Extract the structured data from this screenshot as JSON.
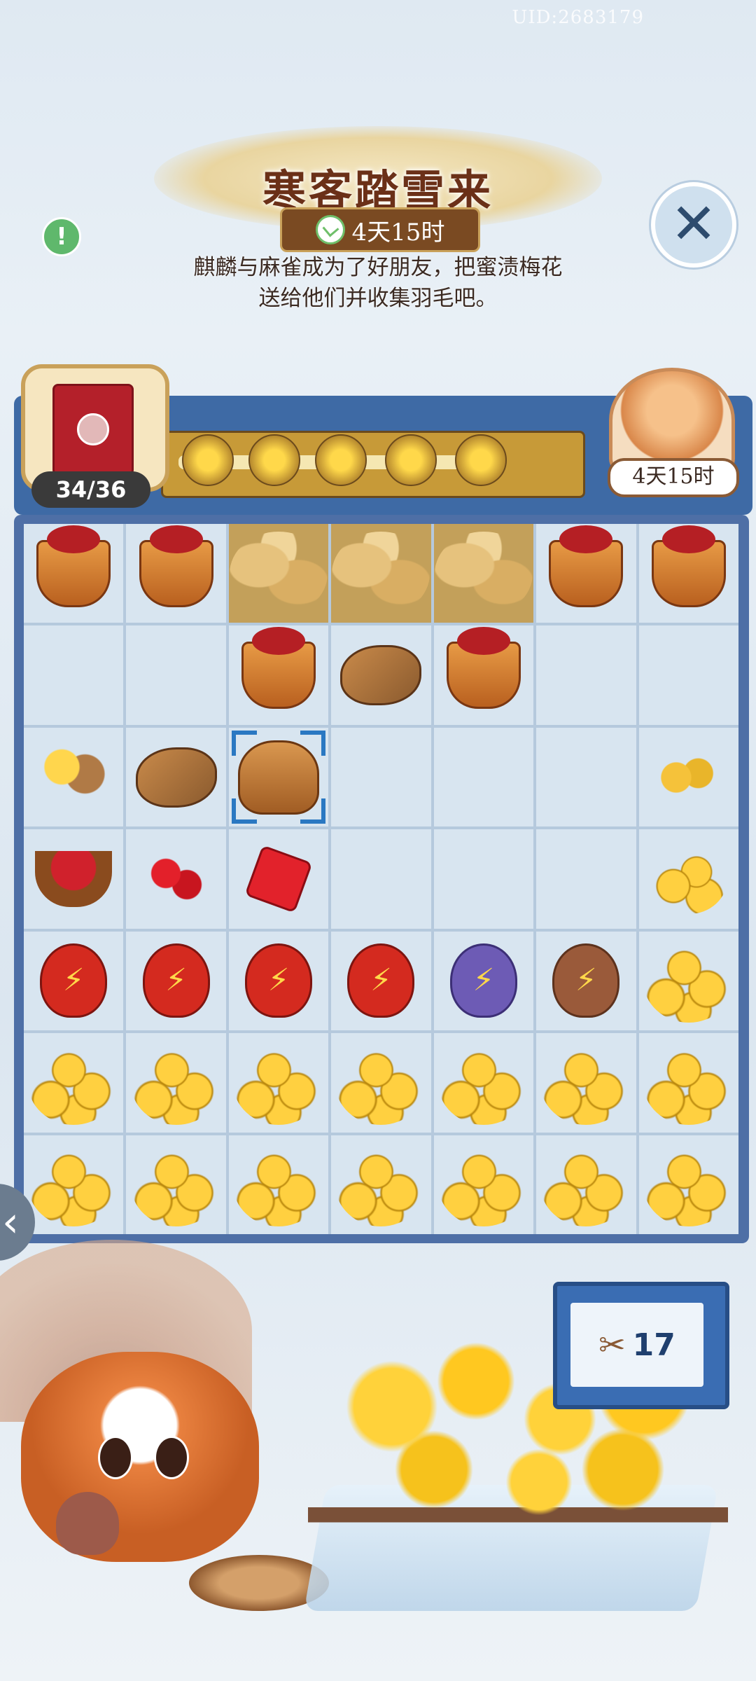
{
  "header": {
    "uid": "UID:2683179",
    "title": "寒客踏雪来",
    "timer": "4天15时",
    "description_line1": "麒麟与麻雀成为了好朋友，把蜜渍梅花",
    "description_line2": "送给他们并收集羽毛吧。",
    "info_icon": "!",
    "close_icon": "✕"
  },
  "progress": {
    "counter": "34/36",
    "reward_timer": "4天15时",
    "items": [
      "flower-bowl-1",
      "flower-bowl-2",
      "flower-bowl-3",
      "flower-bowl-4",
      "flower-bowl-5"
    ]
  },
  "board": {
    "rows": [
      [
        "basket",
        "basket",
        "leaves",
        "leaves",
        "leaves",
        "basket",
        "basket"
      ],
      [
        "empty",
        "empty",
        "basket",
        "bird",
        "basket",
        "empty",
        "empty"
      ],
      [
        "bird-branch",
        "bird",
        "sack-selected",
        "empty",
        "empty",
        "empty",
        "buds"
      ],
      [
        "roses",
        "gems",
        "gem",
        "empty",
        "empty",
        "empty",
        "coins-small"
      ],
      [
        "gourd-red",
        "gourd-red",
        "gourd-red",
        "gourd-red",
        "gourd-purple",
        "gourd-brown",
        "coins-big"
      ],
      [
        "coins-big",
        "coins-big",
        "coins-big",
        "coins-big",
        "coins-big",
        "coins-big",
        "coins-big"
      ],
      [
        "coins-big",
        "coins-big",
        "coins-big",
        "coins-big",
        "coins-big",
        "coins-big",
        "coins-big"
      ]
    ]
  },
  "scene": {
    "shear_count": "17",
    "back_icon": "‹",
    "gourd_glyph": "⚡"
  }
}
